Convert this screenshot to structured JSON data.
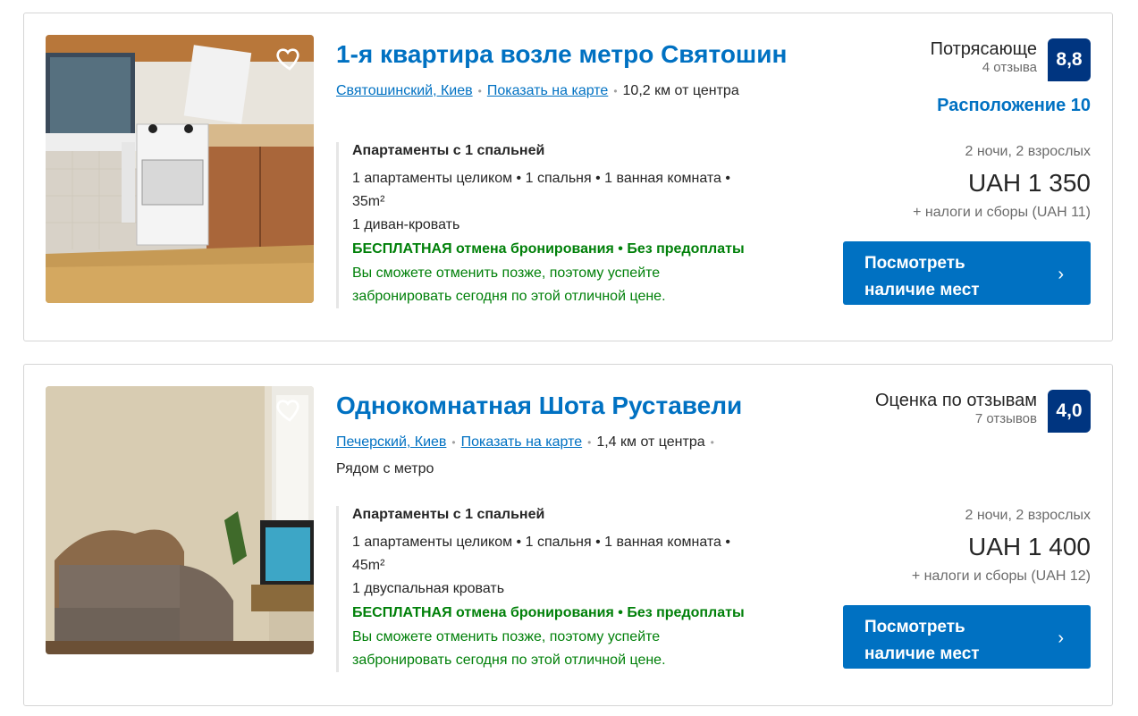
{
  "listings": [
    {
      "title": "1-я квартира возле метро Святошин",
      "district": "Святошинский, Киев",
      "map_link": "Показать на карте",
      "distance": "10,2 км от центра",
      "nearby": "",
      "unit_name": "Апартаменты с 1 спальней",
      "unit_details": "1 апартаменты целиком • 1 спальня • 1 ванная комната •",
      "area": "35m²",
      "bed": "1 диван-кровать",
      "free_cancel": "БЕСПЛАТНАЯ отмена бронирования • Без предоплаты",
      "free_desc": "Вы сможете отменить позже, поэтому успейте забронировать сегодня по этой отличной цене.",
      "score_word": "Потрясающе",
      "review_count": "4 отзыва",
      "score": "8,8",
      "location_score": "Расположение 10",
      "nights": "2 ночи, 2 взрослых",
      "price": "UAH 1 350",
      "taxes": "+ налоги и сборы (UAH 11)",
      "cta": "Посмотреть наличие мест"
    },
    {
      "title": "Однокомнатная Шота Руставели",
      "district": "Печерский, Киев",
      "map_link": "Показать на карте",
      "distance": "1,4 км от центра",
      "nearby": "Рядом с метро",
      "unit_name": "Апартаменты с 1 спальней",
      "unit_details": "1 апартаменты целиком • 1 спальня • 1 ванная комната •",
      "area": "45m²",
      "bed": "1 двуспальная кровать",
      "free_cancel": "БЕСПЛАТНАЯ отмена бронирования • Без предоплаты",
      "free_desc": "Вы сможете отменить позже, поэтому успейте забронировать сегодня по этой отличной цене.",
      "score_word": "Оценка по отзывам",
      "review_count": "7 отзывов",
      "score": "4,0",
      "location_score": "",
      "nights": "2 ночи, 2 взрослых",
      "price": "UAH 1 400",
      "taxes": "+ налоги и сборы (UAH 12)",
      "cta": "Посмотреть наличие мест"
    }
  ],
  "colors": {
    "link": "#0071c2",
    "score_badge": "#003580",
    "free_green": "#008009",
    "cta_bg": "#0071c2"
  },
  "icons": {
    "favorite": "heart-icon",
    "cta_arrow": "chevron-right-icon"
  }
}
